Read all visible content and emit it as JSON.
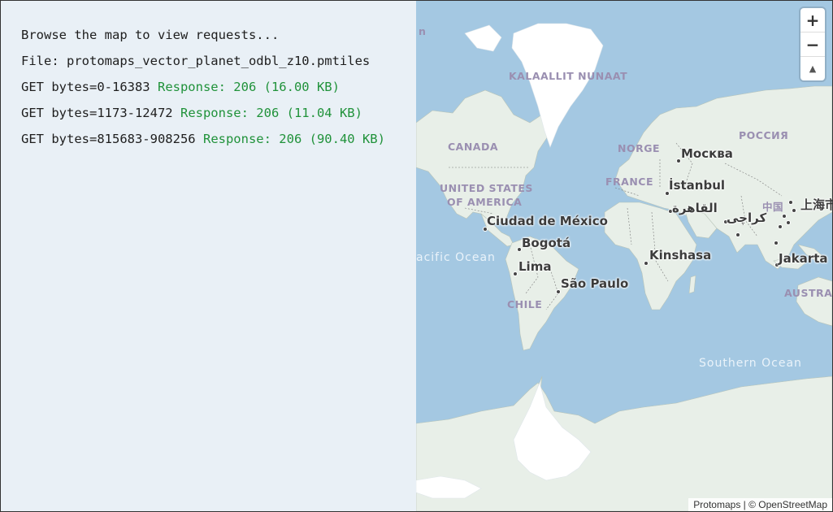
{
  "log": {
    "intro": "Browse the map to view requests...",
    "file_line": "File: protomaps_vector_planet_odbl_z10.pmtiles",
    "requests": [
      {
        "request": "GET bytes=0-16383",
        "response": "Response: 206 (16.00 KB)"
      },
      {
        "request": "GET bytes=1173-12472",
        "response": "Response: 206 (11.04 KB)"
      },
      {
        "request": "GET bytes=815683-908256",
        "response": "Response: 206 (90.40 KB)"
      }
    ]
  },
  "map": {
    "labels": {
      "greenland": "KALAALLIT NUNAAT",
      "canada": "CANADA",
      "usa_1": "UNITED STATES",
      "usa_2": "OF AMERICA",
      "norway": "NORGE",
      "russia": "РОССИЯ",
      "france": "FRANCE",
      "china": "中国",
      "chile": "CHILE",
      "australia": "AUSTRAL",
      "edge_n": "n",
      "moscow": "Москва",
      "istanbul": "İstanbul",
      "cairo": "القاهرة",
      "karachi": "كراچی",
      "shanghai": "上海市",
      "mexico_city": "Ciudad de México",
      "bogota": "Bogotá",
      "lima": "Lima",
      "kinshasa": "Kinshasa",
      "sao_paulo": "São Paulo",
      "jakarta": "Jakarta",
      "pacific": "acific Ocean",
      "southern": "Southern Ocean"
    },
    "zoom_in": "+",
    "zoom_out": "−",
    "compass": "▲",
    "attribution": "Protomaps | © OpenStreetMap",
    "colors": {
      "water": "#a4c8e2",
      "land": "#e8efe8",
      "ice": "#ffffff",
      "border": "#7a7a7a"
    }
  }
}
